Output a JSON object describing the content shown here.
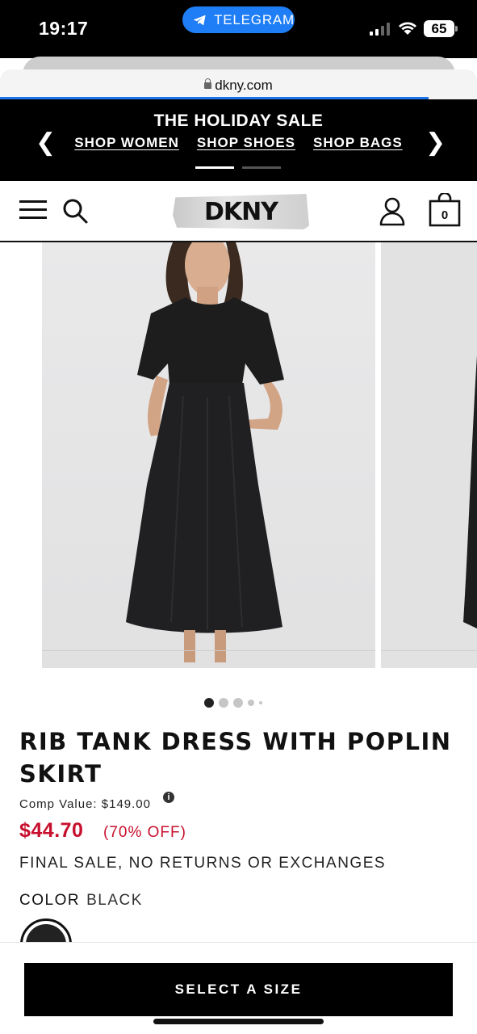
{
  "status": {
    "time": "19:17",
    "pill_label": "TELEGRAM",
    "battery": "65"
  },
  "browser": {
    "url": "dkny.com"
  },
  "promo": {
    "title": "THE HOLIDAY SALE",
    "links": [
      "SHOP WOMEN",
      "SHOP SHOES",
      "SHOP BAGS"
    ],
    "prev_glyph": "❮",
    "next_glyph": "❯"
  },
  "header": {
    "logo": "DKNY",
    "bag_count": "0"
  },
  "product": {
    "title": "RIB TANK DRESS WITH POPLIN SKIRT",
    "comp_value": "Comp Value: $149.00",
    "price": "$44.70",
    "discount": "(70% OFF)",
    "final_sale": "FINAL SALE, NO RETURNS OR EXCHANGES",
    "color_label": "COLOR",
    "color_value": "BLACK",
    "info_glyph": "i"
  },
  "gallery": {
    "image_count": 5,
    "active_index": 0
  },
  "cta": {
    "label": "SELECT A SIZE"
  },
  "colors": {
    "accent_blue": "#1f7ef5",
    "sale_red": "#c8102e",
    "black": "#000000"
  }
}
